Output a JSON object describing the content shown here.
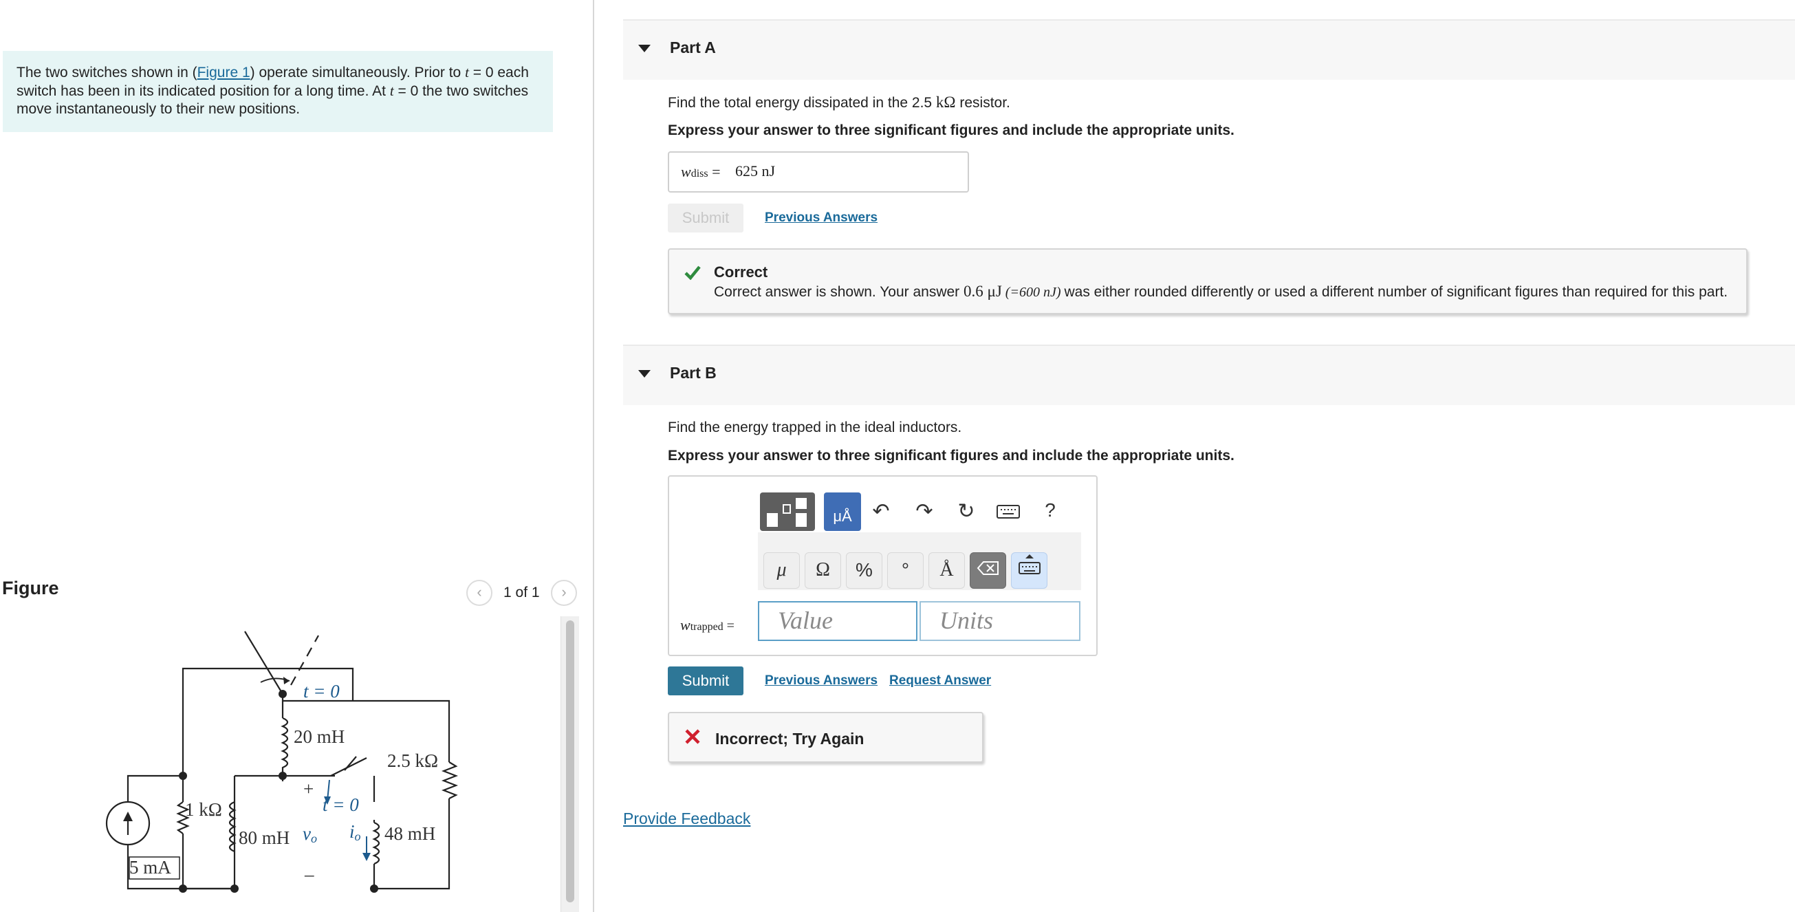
{
  "problem": {
    "text_1": "The two switches shown in (",
    "figure_link": "Figure 1",
    "text_2": ") operate simultaneously. Prior to ",
    "t": "t",
    "text_3": " = 0 each",
    "line2_a": "switch has been in its indicated position for a long time. At ",
    "line2_b": " = 0 the two switches",
    "line3": "move instantaneously to their new positions."
  },
  "figure": {
    "heading": "Figure",
    "page_indicator": "1 of 1",
    "prev_icon": "chevron-left-icon",
    "next_icon": "chevron-right-icon",
    "labels": {
      "t0_top": "t = 0",
      "l20": "20 mH",
      "r25": "2.5 kΩ",
      "plus": "+",
      "t0_mid": "t = 0",
      "r1": "1 kΩ",
      "l80": "80 mH",
      "vo": "v",
      "vo_sub": "o",
      "io": "i",
      "io_sub": "o",
      "l48": "48 mH",
      "src": "5 mA",
      "minus": "–"
    }
  },
  "part_a": {
    "title": "Part A",
    "question_1": "Find the total energy dissipated in the 2.5 ",
    "question_unit": "kΩ",
    "question_2": " resistor.",
    "instruction": "Express your answer to three significant figures and include the appropriate units.",
    "var": "w",
    "var_sub": "diss",
    "equals": "=",
    "value": "625 nJ",
    "submit": "Submit",
    "previous_answers": "Previous Answers",
    "feedback_title": "Correct",
    "feedback_msg_1": "Correct answer is shown. Your answer ",
    "feedback_msg_2": "0.6 μJ",
    "feedback_msg_3": " (=600 nJ) ",
    "feedback_msg_4": "was either rounded differently or used a different number of significant figures than required for this part."
  },
  "part_b": {
    "title": "Part B",
    "question": "Find the energy trapped in the ideal inductors.",
    "instruction": "Express your answer to three significant figures and include the appropriate units.",
    "var": "w",
    "var_sub": "trapped",
    "equals": "=",
    "value_placeholder": "Value",
    "units_placeholder": "Units",
    "toolbar": {
      "help": "?",
      "sym_mu": "μ",
      "sym_ohm": "Ω",
      "sym_percent": "%",
      "sym_degree": "°",
      "sym_angstrom": "Å",
      "units_tab": "μÅ"
    },
    "submit": "Submit",
    "previous_answers": "Previous Answers",
    "request_answer": "Request Answer",
    "feedback_title": "Incorrect; Try Again"
  },
  "provide_feedback": "Provide Feedback",
  "colors": {
    "accent": "#2e7797",
    "link": "#1a6a9a",
    "problem_bg": "#e6f5f5",
    "correct": "#2e8b3e",
    "incorrect": "#d0202e"
  }
}
